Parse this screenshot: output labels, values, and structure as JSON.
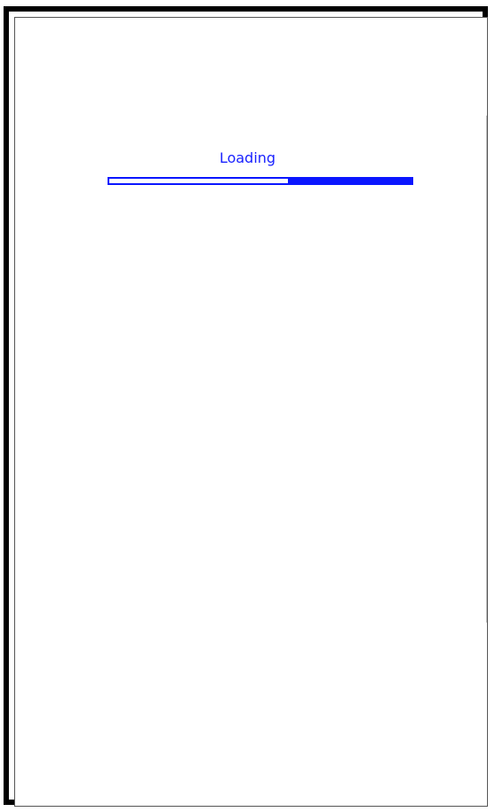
{
  "loading": {
    "label": "Loading",
    "progress_fraction": 0.41
  },
  "colors": {
    "accent": "#0A16FF",
    "frame": "#000000",
    "background": "#FFFFFF"
  }
}
